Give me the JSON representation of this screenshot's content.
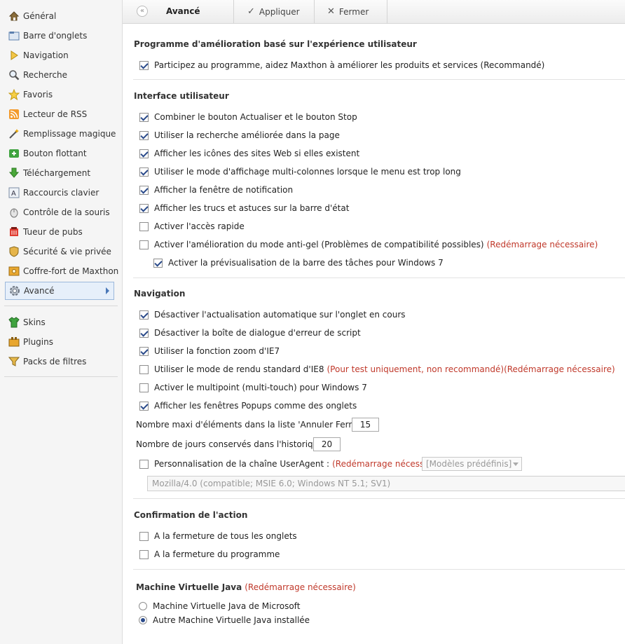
{
  "sidebar": {
    "items": [
      {
        "label": "Général",
        "icon": "home-icon"
      },
      {
        "label": "Barre d'onglets",
        "icon": "tabs-icon"
      },
      {
        "label": "Navigation",
        "icon": "navigation-arrow-icon"
      },
      {
        "label": "Recherche",
        "icon": "search-icon"
      },
      {
        "label": "Favoris",
        "icon": "star-icon"
      },
      {
        "label": "Lecteur de RSS",
        "icon": "rss-icon"
      },
      {
        "label": "Remplissage magique",
        "icon": "magic-wand-icon"
      },
      {
        "label": "Bouton flottant",
        "icon": "floating-button-icon"
      },
      {
        "label": "Téléchargement",
        "icon": "download-icon"
      },
      {
        "label": "Raccourcis clavier",
        "icon": "keyboard-icon"
      },
      {
        "label": "Contrôle de la souris",
        "icon": "mouse-icon"
      },
      {
        "label": "Tueur de pubs",
        "icon": "ad-killer-icon"
      },
      {
        "label": "Sécurité & vie privée",
        "icon": "shield-icon"
      },
      {
        "label": "Coffre-fort de Maxthon",
        "icon": "safe-icon"
      },
      {
        "label": "Avancé",
        "icon": "gear-icon",
        "active": true
      }
    ],
    "extras": [
      {
        "label": "Skins",
        "icon": "shirt-icon"
      },
      {
        "label": "Plugins",
        "icon": "plugin-icon"
      },
      {
        "label": "Packs de filtres",
        "icon": "filter-icon"
      }
    ]
  },
  "toolbar": {
    "title": "Avancé",
    "apply_label": "Appliquer",
    "close_label": "Fermer"
  },
  "sections": {
    "program": {
      "title": "Programme d'amélioration basé sur l'expérience utilisateur",
      "options": [
        {
          "label": "Participez au programme, aidez Maxthon à améliorer les produits et services (Recommandé)",
          "checked": true
        }
      ]
    },
    "ui": {
      "title": "Interface utilisateur",
      "options": [
        {
          "label": "Combiner le bouton Actualiser et le bouton Stop",
          "checked": true
        },
        {
          "label": "Utiliser la recherche améliorée dans la page",
          "checked": true
        },
        {
          "label": "Afficher les icônes des sites Web si elles existent",
          "checked": true
        },
        {
          "label": "Utiliser le mode d'affichage multi-colonnes lorsque le menu est trop long",
          "checked": true
        },
        {
          "label": "Afficher la fenêtre de notification",
          "checked": true
        },
        {
          "label": "Afficher les trucs et astuces sur la barre d'état",
          "checked": true
        },
        {
          "label": "Activer l'accès rapide",
          "checked": false
        },
        {
          "label": "Activer l'amélioration du mode anti-gel (Problèmes de compatibilité possibles)",
          "note": "(Redémarrage nécessaire)",
          "checked": false
        },
        {
          "label": "Activer la prévisualisation de la barre des tâches pour Windows 7",
          "checked": true
        }
      ]
    },
    "navigation": {
      "title": "Navigation",
      "options": [
        {
          "label": "Désactiver l'actualisation automatique sur l'onglet en cours",
          "checked": true
        },
        {
          "label": "Désactiver la boîte de dialogue d'erreur de script",
          "checked": true
        },
        {
          "label": "Utiliser la fonction zoom d'IE7",
          "checked": true
        },
        {
          "label": "Utiliser le mode de rendu standard d'IE8",
          "note": "(Pour test uniquement, non recommandé)(Redémarrage nécessaire)",
          "checked": false
        },
        {
          "label": "Activer le multipoint (multi-touch) pour Windows 7",
          "checked": false
        },
        {
          "label": "Afficher les fenêtres Popups comme des onglets",
          "checked": true
        }
      ],
      "max_items_label": "Nombre maxi d'éléments dans la liste 'Annuler Fermer' :",
      "max_items_value": "15",
      "history_label": "Nombre de jours conservés dans l'historique :",
      "history_value": "20",
      "useragent_label": "Personnalisation de la chaîne UserAgent :",
      "useragent_note": "(Redémarrage nécessaire)",
      "useragent_checked": false,
      "useragent_select": "[Modèles prédéfinis]",
      "useragent_value": "Mozilla/4.0 (compatible; MSIE 6.0; Windows NT 5.1; SV1)"
    },
    "confirm": {
      "title": "Confirmation de l'action",
      "options": [
        {
          "label": "A la fermeture de tous les onglets",
          "checked": false
        },
        {
          "label": "A la fermeture du programme",
          "checked": false
        }
      ]
    },
    "java": {
      "title": "Machine Virtuelle Java",
      "note": "(Redémarrage nécessaire)",
      "options": [
        {
          "label": "Machine Virtuelle Java de Microsoft",
          "selected": false
        },
        {
          "label": "Autre Machine Virtuelle Java installée",
          "selected": true
        }
      ]
    }
  }
}
